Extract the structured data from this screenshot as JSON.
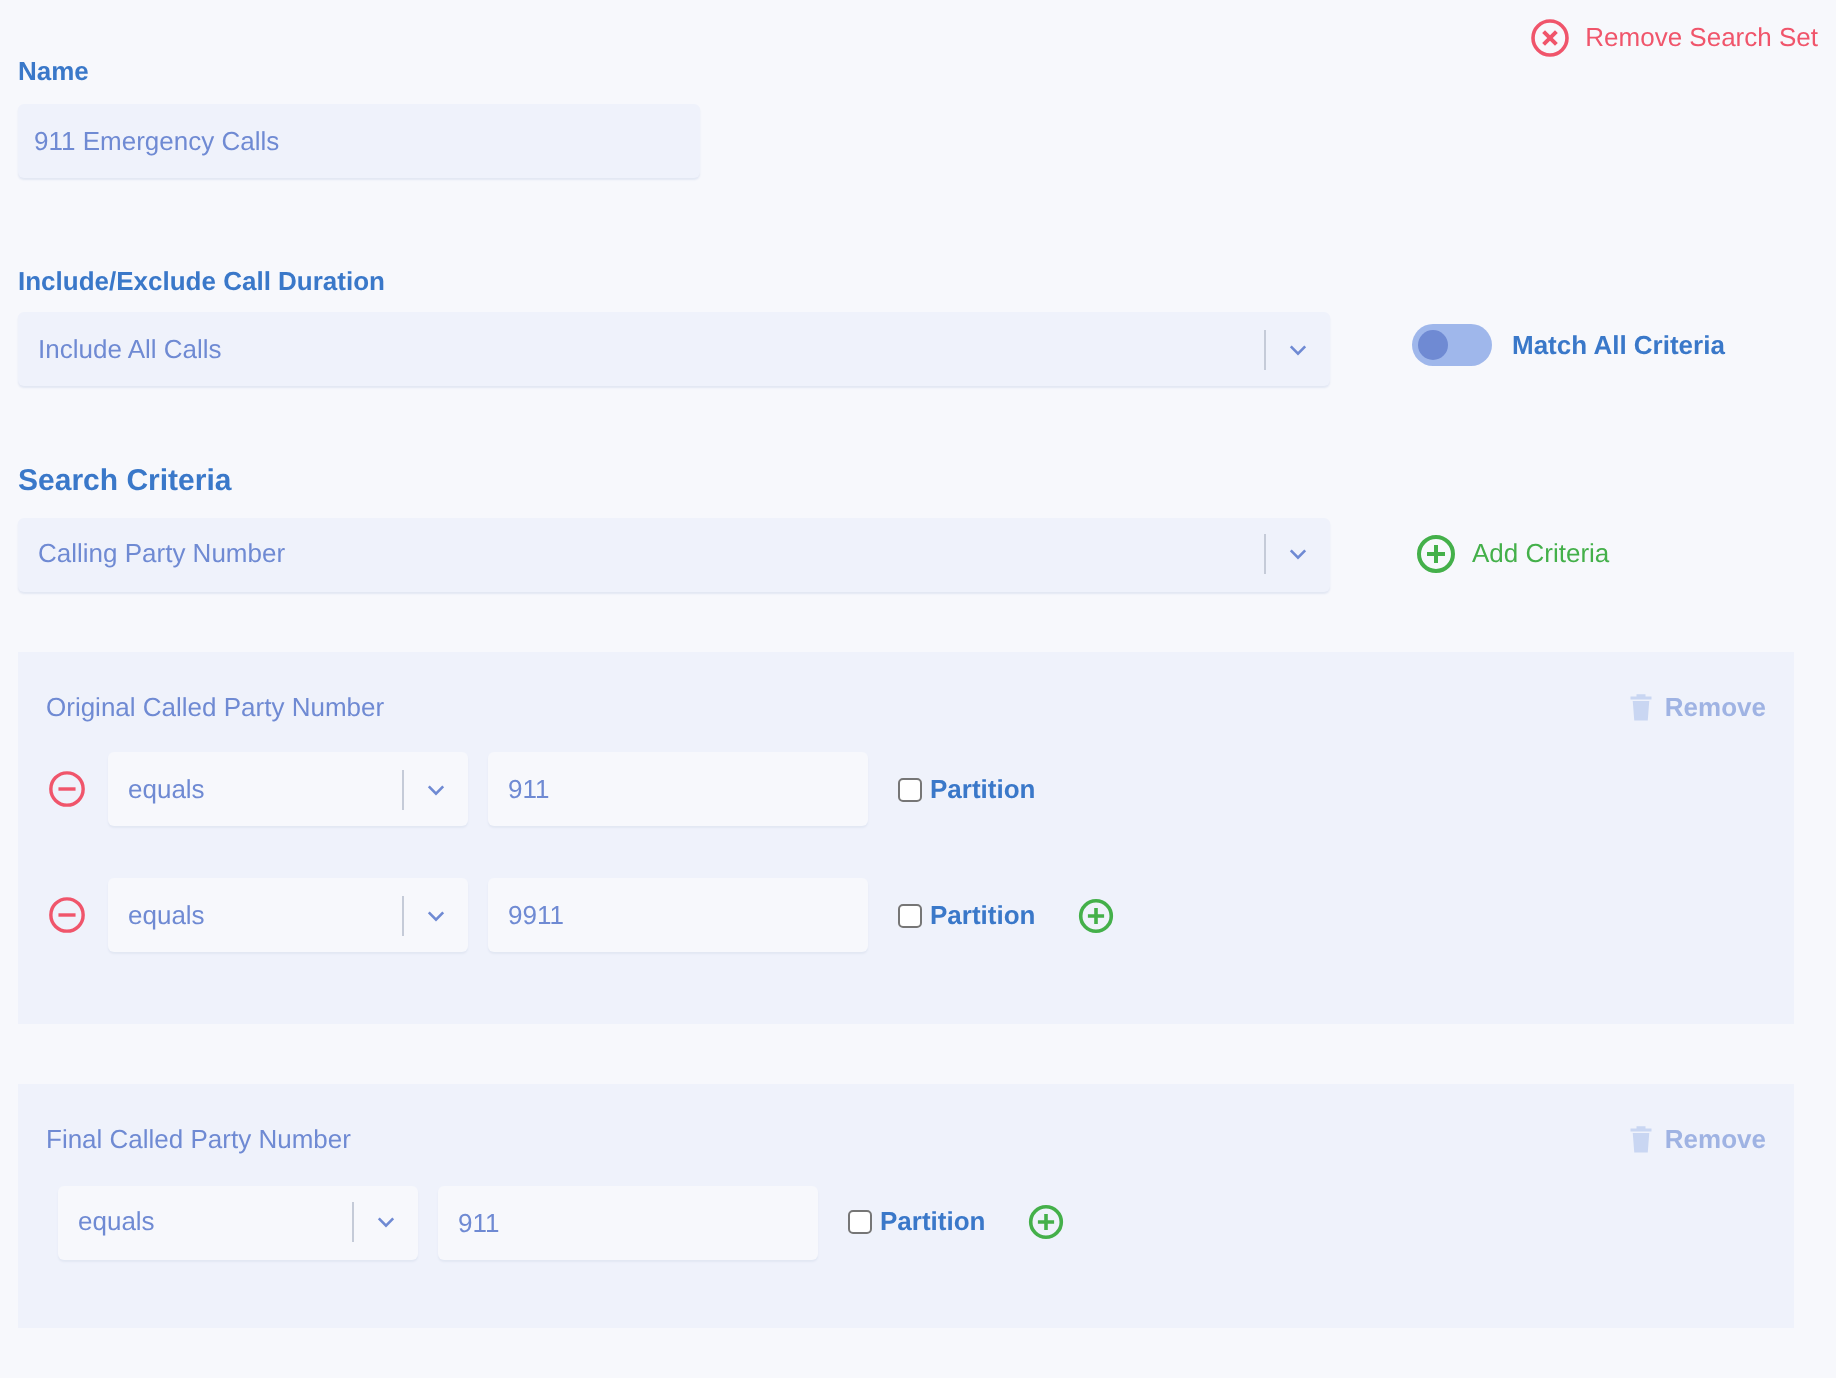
{
  "remove_search_set": "Remove Search Set",
  "name": {
    "label": "Name",
    "value": "911 Emergency Calls"
  },
  "duration": {
    "label": "Include/Exclude Call Duration",
    "value": "Include All Calls"
  },
  "match_all": {
    "label": "Match All Criteria",
    "on": false
  },
  "search_criteria": {
    "heading": "Search Criteria",
    "value": "Calling Party Number",
    "add_label": "Add Criteria"
  },
  "criteria": [
    {
      "title": "Original Called Party Number",
      "remove_label": "Remove",
      "rows": [
        {
          "removable": true,
          "operator": "equals",
          "value": "911",
          "partition_label": "Partition",
          "checked": false,
          "addable": false
        },
        {
          "removable": true,
          "operator": "equals",
          "value": "9911",
          "partition_label": "Partition",
          "checked": false,
          "addable": true
        }
      ]
    },
    {
      "title": "Final Called Party Number",
      "remove_label": "Remove",
      "rows": [
        {
          "removable": false,
          "operator": "equals",
          "value": "911",
          "partition_label": "Partition",
          "checked": false,
          "addable": true
        }
      ]
    }
  ]
}
